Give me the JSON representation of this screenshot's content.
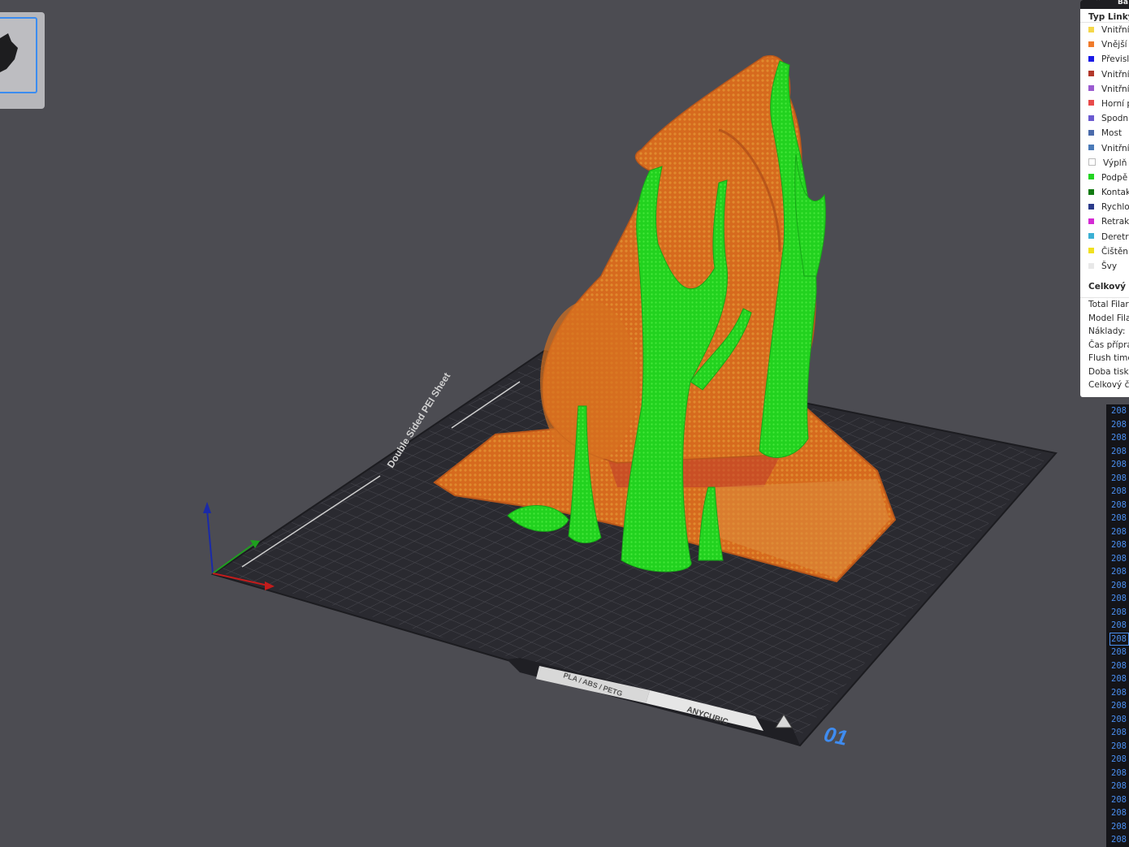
{
  "bed": {
    "sheet_label": "Double Sided PEI Sheet",
    "material_label": "PLA / ABS / PETG",
    "brand_label": "ANYCUBIC",
    "plate_number": "01"
  },
  "legend": {
    "title": "Ba",
    "line_type_header": "Typ Linky",
    "items": [
      {
        "label": "Vnitřní",
        "color": "#f5d74a"
      },
      {
        "label": "Vnější s",
        "color": "#f07a2a"
      },
      {
        "label": "Převisl",
        "color": "#1a1ae6"
      },
      {
        "label": "Vnitřní",
        "color": "#b2372a"
      },
      {
        "label": "Vnitřní",
        "color": "#9a5ad0"
      },
      {
        "label": "Horní p",
        "color": "#e84a4a"
      },
      {
        "label": "Spodní",
        "color": "#6a5ad0"
      },
      {
        "label": "Most",
        "color": "#4a6aaa"
      },
      {
        "label": "Vnitřní",
        "color": "#4a7ab8"
      },
      {
        "label": "Výplň r",
        "color": "#ffffff"
      },
      {
        "label": "Podpě",
        "color": "#22d422"
      },
      {
        "label": "Kontak",
        "color": "#127a12"
      },
      {
        "label": "Rychlo",
        "color": "#2a3a8a"
      },
      {
        "label": "Retrak",
        "color": "#d42ad4"
      },
      {
        "label": "Deretr",
        "color": "#3ab0d4"
      },
      {
        "label": "Čištění",
        "color": "#f0e020"
      },
      {
        "label": "Švy",
        "color": "#e8e8e8"
      }
    ],
    "summary_header": "Celkový c",
    "stats": [
      "Total Filar",
      "Model Fila",
      "Náklady:",
      "Čas přípra",
      "Flush time",
      "Doba tisku",
      "Celkový č"
    ]
  },
  "gcode": {
    "rows": [
      "208",
      "208",
      "208",
      "208",
      "208",
      "208",
      "208",
      "208",
      "208",
      "208",
      "208",
      "208",
      "208",
      "208",
      "208",
      "208",
      "208",
      "208",
      "208",
      "208",
      "208",
      "208",
      "208",
      "208",
      "208",
      "208",
      "208",
      "208",
      "208",
      "208",
      "208",
      "208",
      "208"
    ],
    "selected_index": 17
  }
}
